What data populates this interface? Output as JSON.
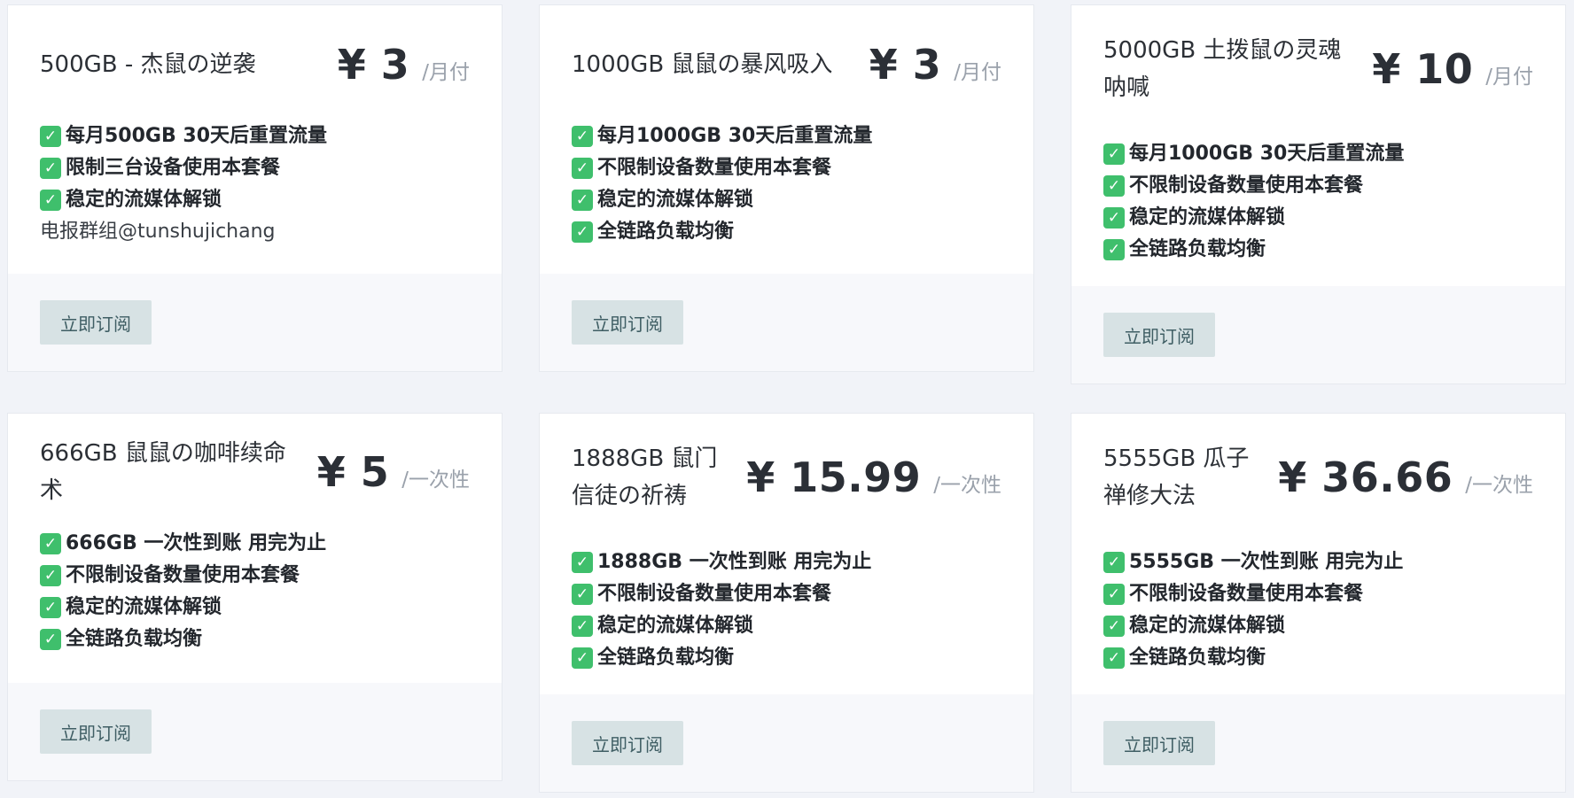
{
  "plans": [
    {
      "name": "500GB - 杰鼠の逆袭",
      "price": "¥ 3",
      "period": "/月付",
      "features": [
        "每月500GB 30天后重置流量",
        "限制三台设备使用本套餐",
        "稳定的流媒体解锁"
      ],
      "note": "电报群组@tunshujichang",
      "button": "立即订阅"
    },
    {
      "name": "1000GB 鼠鼠の暴风吸入",
      "price": "¥ 3",
      "period": "/月付",
      "features": [
        "每月1000GB 30天后重置流量",
        "不限制设备数量使用本套餐",
        "稳定的流媒体解锁",
        "全链路负载均衡"
      ],
      "button": "立即订阅"
    },
    {
      "name": "5000GB 土拨鼠の灵魂呐喊",
      "price": "¥ 10",
      "period": "/月付",
      "features": [
        "每月1000GB 30天后重置流量",
        "不限制设备数量使用本套餐",
        "稳定的流媒体解锁",
        "全链路负载均衡"
      ],
      "button": "立即订阅"
    },
    {
      "name": "666GB 鼠鼠の咖啡续命术",
      "price": "¥ 5",
      "period": "/一次性",
      "features": [
        "666GB 一次性到账 用完为止",
        "不限制设备数量使用本套餐",
        "稳定的流媒体解锁",
        "全链路负载均衡"
      ],
      "button": "立即订阅"
    },
    {
      "name": "1888GB 鼠门信徒の祈祷",
      "price": "¥ 15.99",
      "period": "/一次性",
      "features": [
        "1888GB 一次性到账 用完为止",
        "不限制设备数量使用本套餐",
        "稳定的流媒体解锁",
        "全链路负载均衡"
      ],
      "button": "立即订阅"
    },
    {
      "name": "5555GB 瓜子禅修大法",
      "price": "¥ 36.66",
      "period": "/一次性",
      "features": [
        "5555GB 一次性到账 用完为止",
        "不限制设备数量使用本套餐",
        "稳定的流媒体解锁",
        "全链路负载均衡"
      ],
      "button": "立即订阅"
    }
  ],
  "icons": {
    "check": "check-box-icon"
  },
  "colors": {
    "page_bg": "#f1f3f8",
    "card_bg": "#ffffff",
    "footer_bg": "#f7f8fb",
    "button_bg": "#d7e2e4",
    "button_text": "#3f5e64",
    "check_green": "#3fbf6c",
    "period_gray": "#9aa1ab"
  }
}
